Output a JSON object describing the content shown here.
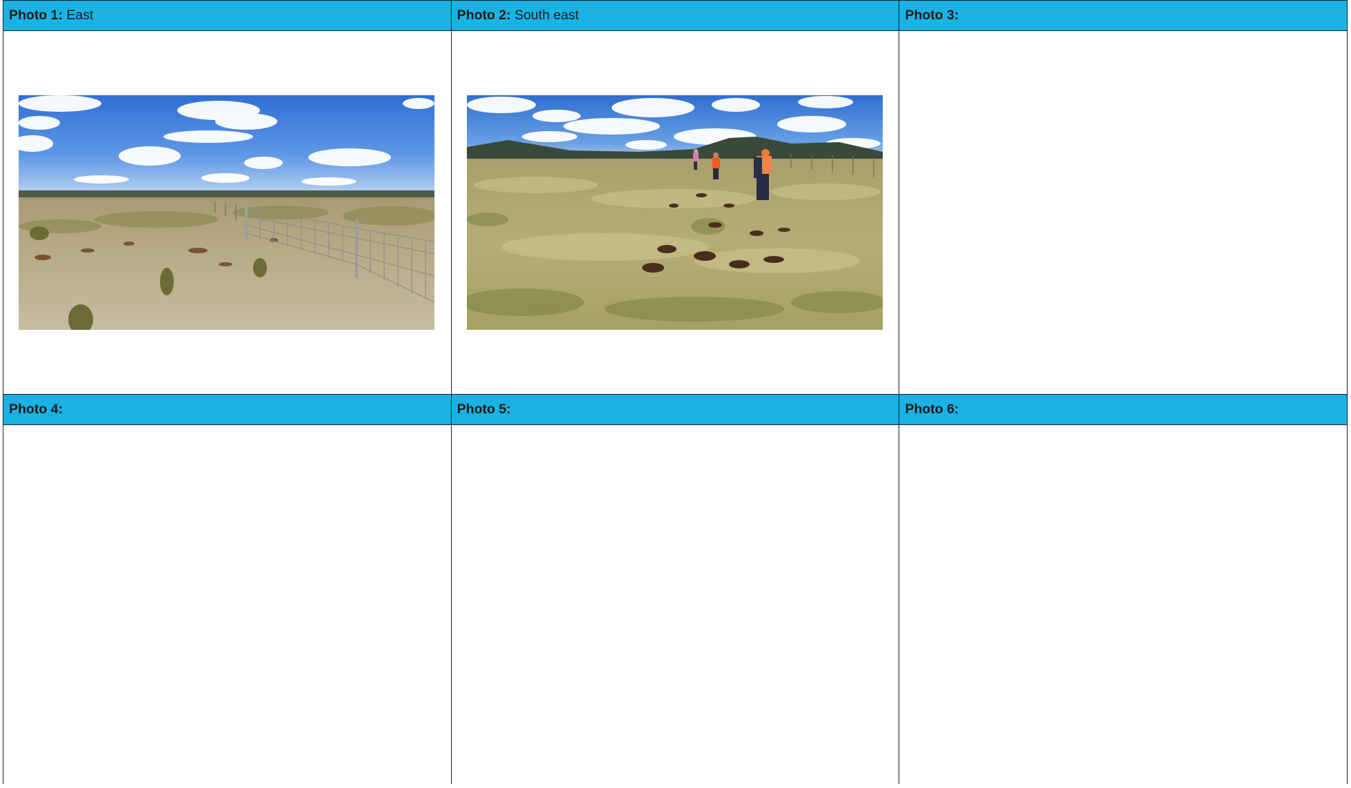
{
  "photos": [
    {
      "label": "Photo 1:",
      "caption": "East"
    },
    {
      "label": "Photo 2:",
      "caption": "South east"
    },
    {
      "label": "Photo 3:",
      "caption": ""
    },
    {
      "label": "Photo 4:",
      "caption": ""
    },
    {
      "label": "Photo 5:",
      "caption": ""
    },
    {
      "label": "Photo 6:",
      "caption": ""
    }
  ],
  "colors": {
    "header_bg": "#19b2e3",
    "border": "#1a1a1a"
  }
}
